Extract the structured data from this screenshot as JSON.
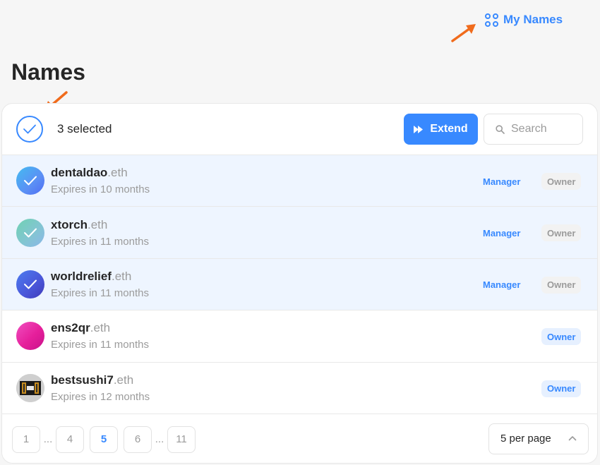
{
  "header": {
    "my_names_label": "My Names",
    "title": "Names"
  },
  "toolbar": {
    "selected_text": "3 selected",
    "extend_label": "Extend",
    "search_placeholder": "Search"
  },
  "names": [
    {
      "label": "dentaldao",
      "tld": ".eth",
      "expires": "Expires in 10 months",
      "manager": "Manager",
      "owner": "Owner",
      "selected": true
    },
    {
      "label": "xtorch",
      "tld": ".eth",
      "expires": "Expires in 11 months",
      "manager": "Manager",
      "owner": "Owner",
      "selected": true
    },
    {
      "label": "worldrelief",
      "tld": ".eth",
      "expires": "Expires in 11 months",
      "manager": "Manager",
      "owner": "Owner",
      "selected": true
    },
    {
      "label": "ens2qr",
      "tld": ".eth",
      "expires": "Expires in 11 months",
      "owner": "Owner",
      "selected": false
    },
    {
      "label": "bestsushi7",
      "tld": ".eth",
      "expires": "Expires in 12 months",
      "owner": "Owner",
      "selected": false
    }
  ],
  "pagination": {
    "pages": [
      "1",
      "4",
      "5",
      "6",
      "11"
    ],
    "ellipsis": "...",
    "current": "5",
    "per_page_label": "5 per page"
  },
  "colors": {
    "accent": "#3889ff",
    "arrow": "#f06b1c",
    "selected_row": "#eef5ff"
  }
}
